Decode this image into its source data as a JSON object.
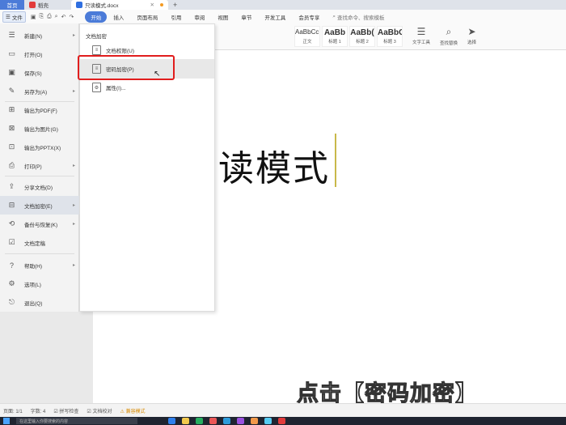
{
  "titlebar": {
    "home_tab": "首页",
    "wps_tab": "稻壳",
    "doc_tab": "只读模式.docx",
    "new_tab": "+",
    "colors": {
      "home_bg": "#4b7bd8",
      "wps_logo": "#e23b3b",
      "doc_logo": "#2f6fe0"
    }
  },
  "ribbon": {
    "file_button": "文件",
    "tabs": [
      "开始",
      "插入",
      "页面布局",
      "引用",
      "审阅",
      "视图",
      "章节",
      "开发工具",
      "会员专享"
    ],
    "active_tab": "开始",
    "search_placeholder": "查找命令、搜索模板",
    "styles": [
      {
        "sample": "AaBbCcDd",
        "name": "正文"
      },
      {
        "sample": "AaBb",
        "name": "标题 1"
      },
      {
        "sample": "AaBb(",
        "name": "标题 2"
      },
      {
        "sample": "AaBbCc",
        "name": "标题 3"
      }
    ],
    "right_tools": [
      {
        "icon": "text-tools-icon",
        "label": "文字工具"
      },
      {
        "icon": "find-replace-icon",
        "label": "查找替换"
      },
      {
        "icon": "select-icon",
        "label": "选择"
      }
    ]
  },
  "file_menu": {
    "items": [
      {
        "label": "新建(N)",
        "icon": "new-icon",
        "has_arrow": true
      },
      {
        "label": "打开(O)",
        "icon": "open-folder-icon",
        "has_arrow": false
      },
      {
        "label": "保存(S)",
        "icon": "save-icon",
        "has_arrow": false
      },
      {
        "label": "另存为(A)",
        "icon": "save-as-icon",
        "has_arrow": true
      },
      {
        "label": "输出为PDF(F)",
        "icon": "pdf-icon",
        "has_arrow": false
      },
      {
        "label": "输出为图片(G)",
        "icon": "image-icon",
        "has_arrow": false
      },
      {
        "label": "输出为PPTX(X)",
        "icon": "pptx-icon",
        "has_arrow": false
      },
      {
        "label": "打印(P)",
        "icon": "print-icon",
        "has_arrow": true
      },
      {
        "label": "分享文档(D)",
        "icon": "share-icon",
        "has_arrow": false
      },
      {
        "label": "文档加密(E)",
        "icon": "encrypt-icon",
        "has_arrow": true
      },
      {
        "label": "备份与恢复(K)",
        "icon": "backup-icon",
        "has_arrow": true
      },
      {
        "label": "文档定稿",
        "icon": "finalize-icon",
        "has_arrow": false
      },
      {
        "label": "帮助(H)",
        "icon": "help-icon",
        "has_arrow": true
      },
      {
        "label": "选项(L)",
        "icon": "options-icon",
        "has_arrow": false
      },
      {
        "label": "退出(Q)",
        "icon": "exit-icon",
        "has_arrow": false
      }
    ],
    "selected": "文档加密(E)"
  },
  "submenu": {
    "title": "文档加密",
    "items": [
      {
        "label": "文档权限(U)",
        "icon": "doc-permission-icon"
      },
      {
        "label": "密码加密(P)",
        "icon": "password-encrypt-icon"
      },
      {
        "label": "属性(I)...",
        "icon": "properties-icon"
      }
    ],
    "highlighted": "密码加密(P)"
  },
  "document": {
    "title_text": "读模式",
    "caption": "点击【密码加密】"
  },
  "statusbar": {
    "page": "页面: 1/1",
    "words": "字数: 4",
    "spell": "拼写检查",
    "proofread": "文档校对",
    "compat": "兼容模式"
  },
  "taskbar": {
    "search": "在这里输入你要搜索的内容"
  }
}
